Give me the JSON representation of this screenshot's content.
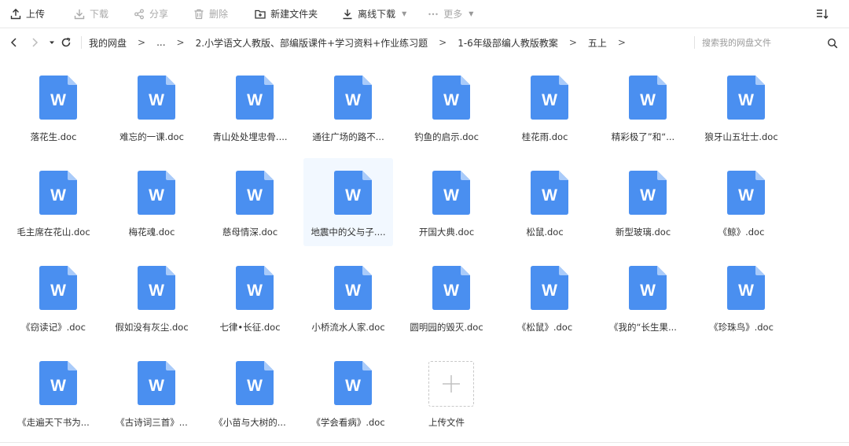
{
  "toolbar": {
    "upload": "上传",
    "download": "下载",
    "share": "分享",
    "delete": "删除",
    "new_folder": "新建文件夹",
    "offline_download": "离线下载",
    "more": "更多"
  },
  "nav": {
    "breadcrumbs": [
      "我的网盘",
      "...",
      "2.小学语文人教版、部编版课件+学习资料+作业练习题",
      "1-6年级部编人教版教案",
      "五上"
    ],
    "search_placeholder": "搜索我的网盘文件"
  },
  "files": [
    "落花生.doc",
    "难忘的一课.doc",
    "青山处处埋忠骨....",
    "通往广场的路不...",
    "钓鱼的启示.doc",
    "桂花雨.doc",
    "精彩极了”和“...",
    "狼牙山五壮士.doc",
    "毛主席在花山.doc",
    "梅花魂.doc",
    "慈母情深.doc",
    "地震中的父与子....",
    "开国大典.doc",
    "松鼠.doc",
    "新型玻璃.doc",
    "《鲸》.doc",
    "《窃读记》.doc",
    "假如没有灰尘.doc",
    "七律•长征.doc",
    "小桥流水人家.doc",
    "圆明园的毁灭.doc",
    "《松鼠》.doc",
    "《我的“长生果...",
    "《珍珠鸟》.doc",
    "《走遍天下书为...",
    "《古诗词三首》...",
    "《小苗与大树的...",
    "《学会看病》.doc"
  ],
  "selected_index": 11,
  "upload_tile_label": "上传文件",
  "colors": {
    "doc_blue": "#4a8ff0",
    "doc_fold": "#a9cbfa",
    "selected_bg": "#f2f8ff"
  }
}
